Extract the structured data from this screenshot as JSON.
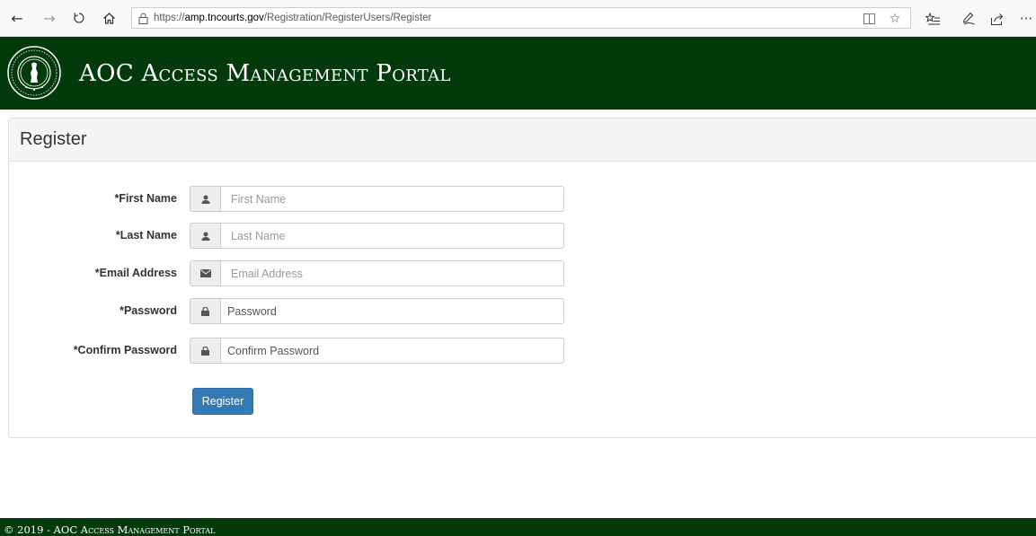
{
  "browser": {
    "url_scheme": "https://",
    "url_host": "amp.tncourts.gov",
    "url_path": "/Registration/RegisterUsers/Register",
    "icons": [
      "back-icon",
      "forward-icon",
      "refresh-icon",
      "home-icon",
      "lock-icon",
      "reading-view-icon",
      "favorite-star-icon",
      "favorites-list-icon",
      "pen-icon",
      "share-icon",
      "more-icon"
    ]
  },
  "header": {
    "title": "AOC Access Management Portal",
    "background_color": "#033a0b"
  },
  "panel": {
    "title": "Register"
  },
  "form": {
    "fields": [
      {
        "label": "*First Name",
        "placeholder": "First Name",
        "icon": "user-icon"
      },
      {
        "label": "*Last Name",
        "placeholder": "Last Name",
        "icon": "user-icon"
      },
      {
        "label": "*Email Address",
        "placeholder": "Email Address",
        "icon": "envelope-icon"
      },
      {
        "label": "*Password",
        "placeholder": "Password",
        "icon": "lock-icon"
      },
      {
        "label": "*Confirm Password",
        "placeholder": "Confirm Password",
        "icon": "lock-icon"
      }
    ],
    "submit_label": "Register",
    "submit_color": "#337ab7"
  },
  "footer": {
    "text": "© 2019 - AOC Access Management Portal"
  }
}
